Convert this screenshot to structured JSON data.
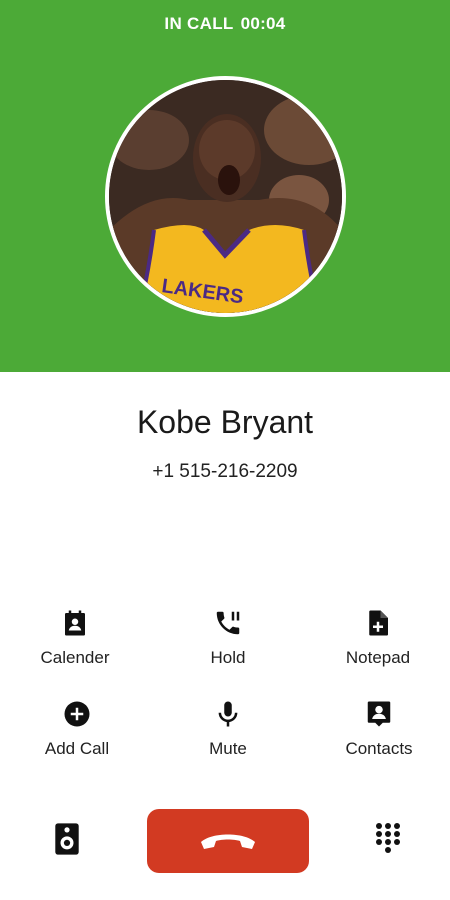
{
  "status": {
    "state": "IN CALL",
    "timer": "00:04"
  },
  "caller": {
    "name": "Kobe Bryant",
    "number": "+1 515-216-2209"
  },
  "actions": [
    {
      "label": "Calender",
      "icon": "calendar-contact-icon"
    },
    {
      "label": "Hold",
      "icon": "phone-pause-icon"
    },
    {
      "label": "Notepad",
      "icon": "note-add-icon"
    },
    {
      "label": "Add Call",
      "icon": "add-circle-icon"
    },
    {
      "label": "Mute",
      "icon": "microphone-icon"
    },
    {
      "label": "Contacts",
      "icon": "contact-card-icon"
    }
  ],
  "bottom_bar": {
    "left_icon": "speaker-icon",
    "center_icon": "end-call-icon",
    "right_icon": "dialpad-icon"
  },
  "colors": {
    "header": "#4caa37",
    "end_call": "#d23a22",
    "text": "#1a1a1a"
  }
}
